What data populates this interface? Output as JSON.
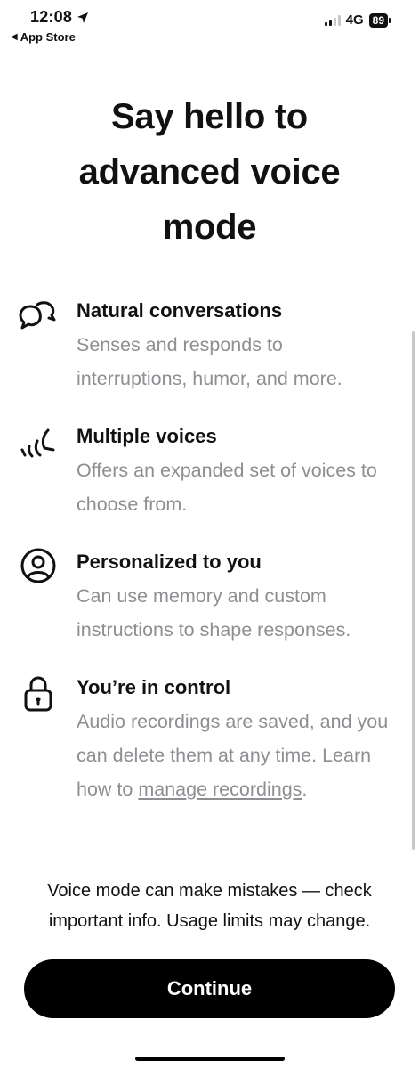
{
  "status_bar": {
    "time": "12:08",
    "back_label": "App Store",
    "network": "4G",
    "battery": "89"
  },
  "title_lines": [
    "Say hello to",
    "advanced voice",
    "mode"
  ],
  "features": [
    {
      "icon": "chat-bubbles-icon",
      "heading": "Natural conversations",
      "description": "Senses and responds to interruptions, humor, and more."
    },
    {
      "icon": "voice-waves-icon",
      "heading": "Multiple voices",
      "description": "Offers an expanded set of voices to choose from."
    },
    {
      "icon": "person-circle-icon",
      "heading": "Personalized to you",
      "description": "Can use memory and custom instructions to shape responses."
    },
    {
      "icon": "lock-icon",
      "heading": "You’re in control",
      "description": "Audio recordings are saved, and you can delete them at any time.",
      "learn_prefix": "Learn how to",
      "learn_link": "manage recordings",
      "learn_suffix": "."
    }
  ],
  "disclaimer": "Voice mode can make mistakes — check important info. Usage limits may change.",
  "continue_label": "Continue"
}
